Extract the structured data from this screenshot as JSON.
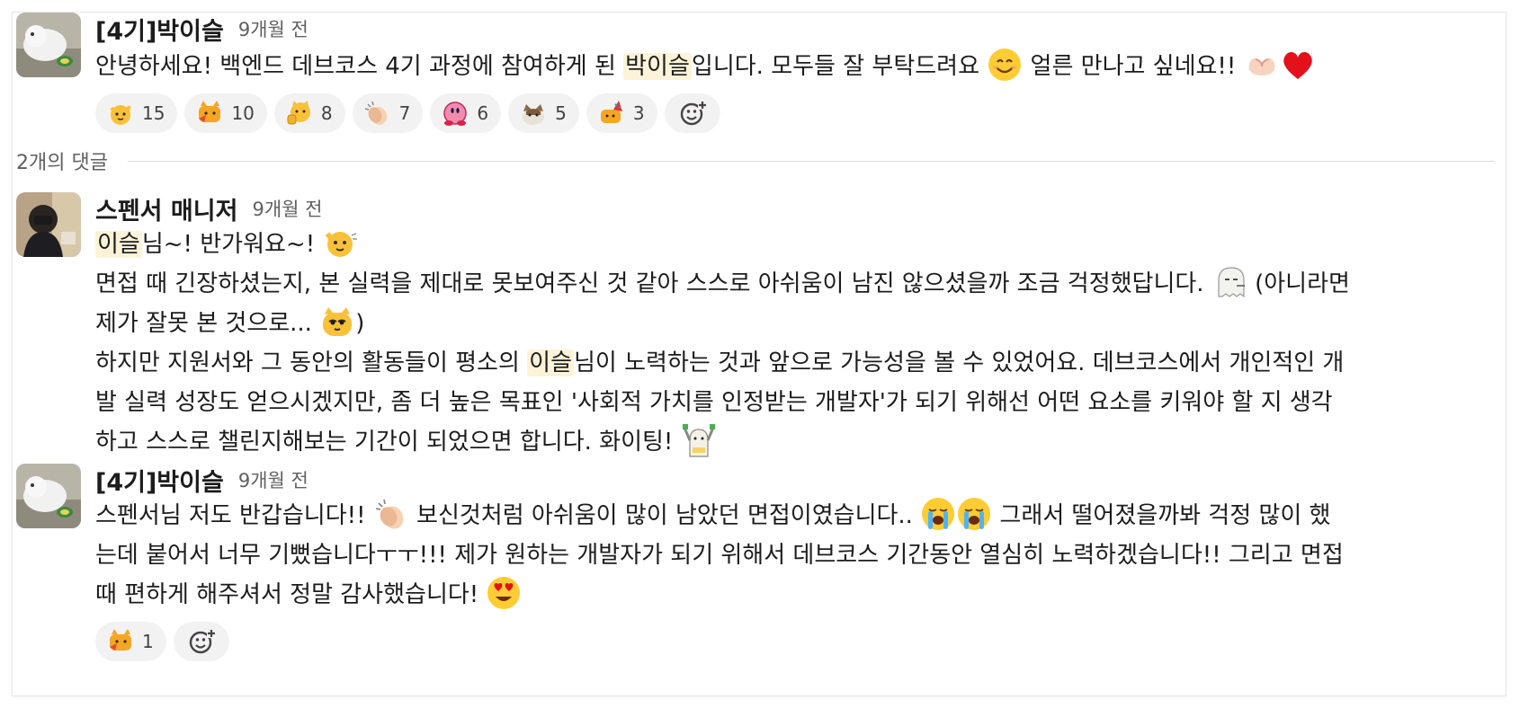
{
  "root_message": {
    "author": "[4기]박이슬",
    "time": "9개월 전",
    "text": {
      "pre": "안녕하세요! 백엔드 데브코스 4기 과정에 참여하게 된 ",
      "mention": "박이슬",
      "post": "입니다. 모두들 잘 부탁드려요 ",
      "post2": " 얼른 만나고 싶네요!! "
    },
    "reactions": [
      {
        "icon": "cheering-hand-cat-icon",
        "count": "15"
      },
      {
        "icon": "orange-cat-fire-icon",
        "count": "10"
      },
      {
        "icon": "thumbs-up-cat-icon",
        "count": "8"
      },
      {
        "icon": "clapping-hands-icon",
        "count": "7"
      },
      {
        "icon": "kirby-icon",
        "count": "6"
      },
      {
        "icon": "cat-face-icon",
        "count": "5"
      },
      {
        "icon": "party-cat-icon",
        "count": "3"
      }
    ]
  },
  "replies_divider": "2개의 댓글",
  "reply_1": {
    "author": "스펜서 매니저",
    "time": "9개월 전",
    "line1": {
      "mention": "이슬",
      "post": "님~! 반가워요~! "
    },
    "line2": {
      "pre": "면접 때 긴장하셨는지, 본 실력을 제대로 못보여주신 것 같아 스스로 아쉬움이 남진 않으셨을까 조금 걱정했답니다. ",
      "post": " (아니라면"
    },
    "line3": {
      "pre": "제가 잘못 본 것으로... ",
      "post": ")"
    },
    "line4": {
      "pre": "하지만 지원서와 그 동안의 활동들이 평소의 ",
      "mention": "이슬",
      "post": "님이 노력하는 것과 앞으로 가능성을 볼 수 있었어요. 데브코스에서 개인적인 개"
    },
    "line5": "발 실력 성장도 얻으시겠지만, 좀 더 높은 목표인 '사회적 가치를 인정받는 개발자'가 되기 위해선 어떤 요소를 키워야 할 지 생각",
    "line6": {
      "pre": "하고 스스로 챌린지해보는 기간이 되었으면 합니다. 화이팅! "
    }
  },
  "reply_2": {
    "author": "[4기]박이슬",
    "time": "9개월 전",
    "line1": {
      "pre": "스펜서님 저도 반갑습니다!! ",
      "mid": " 보신것처럼 아쉬움이 많이 남았던 면접이였습니다.. ",
      "post": "  그래서 떨어졌을까봐 걱정 많이 했"
    },
    "line2": "는데 붙어서 너무 기뻤습니다ㅜㅜ!!! 제가 원하는 개발자가 되기 위해서 데브코스 기간동안 열심히 노력하겠습니다!! 그리고 면접",
    "line3": {
      "pre": "때 편하게 해주셔서 정말 감사했습니다! "
    },
    "reactions": [
      {
        "icon": "orange-cat-fire-icon",
        "count": "1"
      }
    ]
  }
}
